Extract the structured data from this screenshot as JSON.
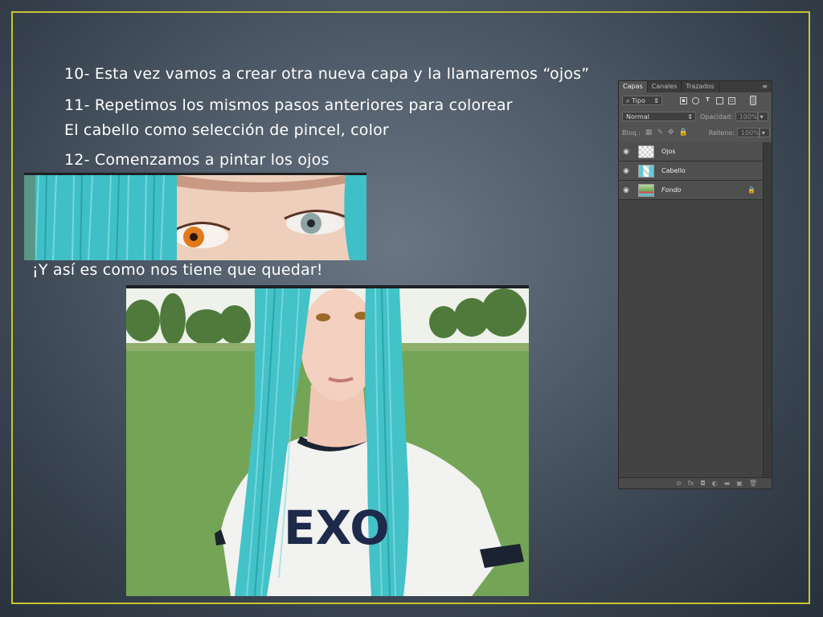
{
  "slide": {
    "line_10": "10- Esta vez vamos a crear otra nueva capa y la llamaremos “ojos”",
    "line_11a": "11- Repetimos los mismos pasos anteriores para colorear",
    "line_11b": "El cabello como selección de pincel, color",
    "line_12": "12- Comenzamos a pintar los ojos",
    "caption": "¡Y así es como nos tiene que quedar!",
    "photo_text": "EXO"
  },
  "layers_panel": {
    "tabs": [
      "Capas",
      "Canales",
      "Trazados"
    ],
    "filter_label": "Tipo",
    "blend_mode": "Normal",
    "opacity_label": "Opacidad:",
    "opacity_value": "100%",
    "lock_label": "Bloq.:",
    "fill_label": "Relleno:",
    "fill_value": "100%",
    "layers": [
      {
        "name": "Ojos",
        "thumb": "transparent"
      },
      {
        "name": "Cabello",
        "thumb": "hair"
      },
      {
        "name": "Fondo",
        "thumb": "photo",
        "locked": true
      }
    ],
    "bottom_icons": [
      "link-icon",
      "fx-icon",
      "mask-icon",
      "adjustment-icon",
      "folder-icon",
      "new-layer-icon",
      "trash-icon"
    ],
    "bottom_labels": [
      "⊝",
      "fx",
      "◘",
      "◐",
      "▬",
      "▣",
      "🗑"
    ]
  },
  "colors": {
    "border": "#c9c431",
    "text": "#ffffff",
    "hair": "#4fc3c7",
    "panel_bg": "#535353"
  }
}
